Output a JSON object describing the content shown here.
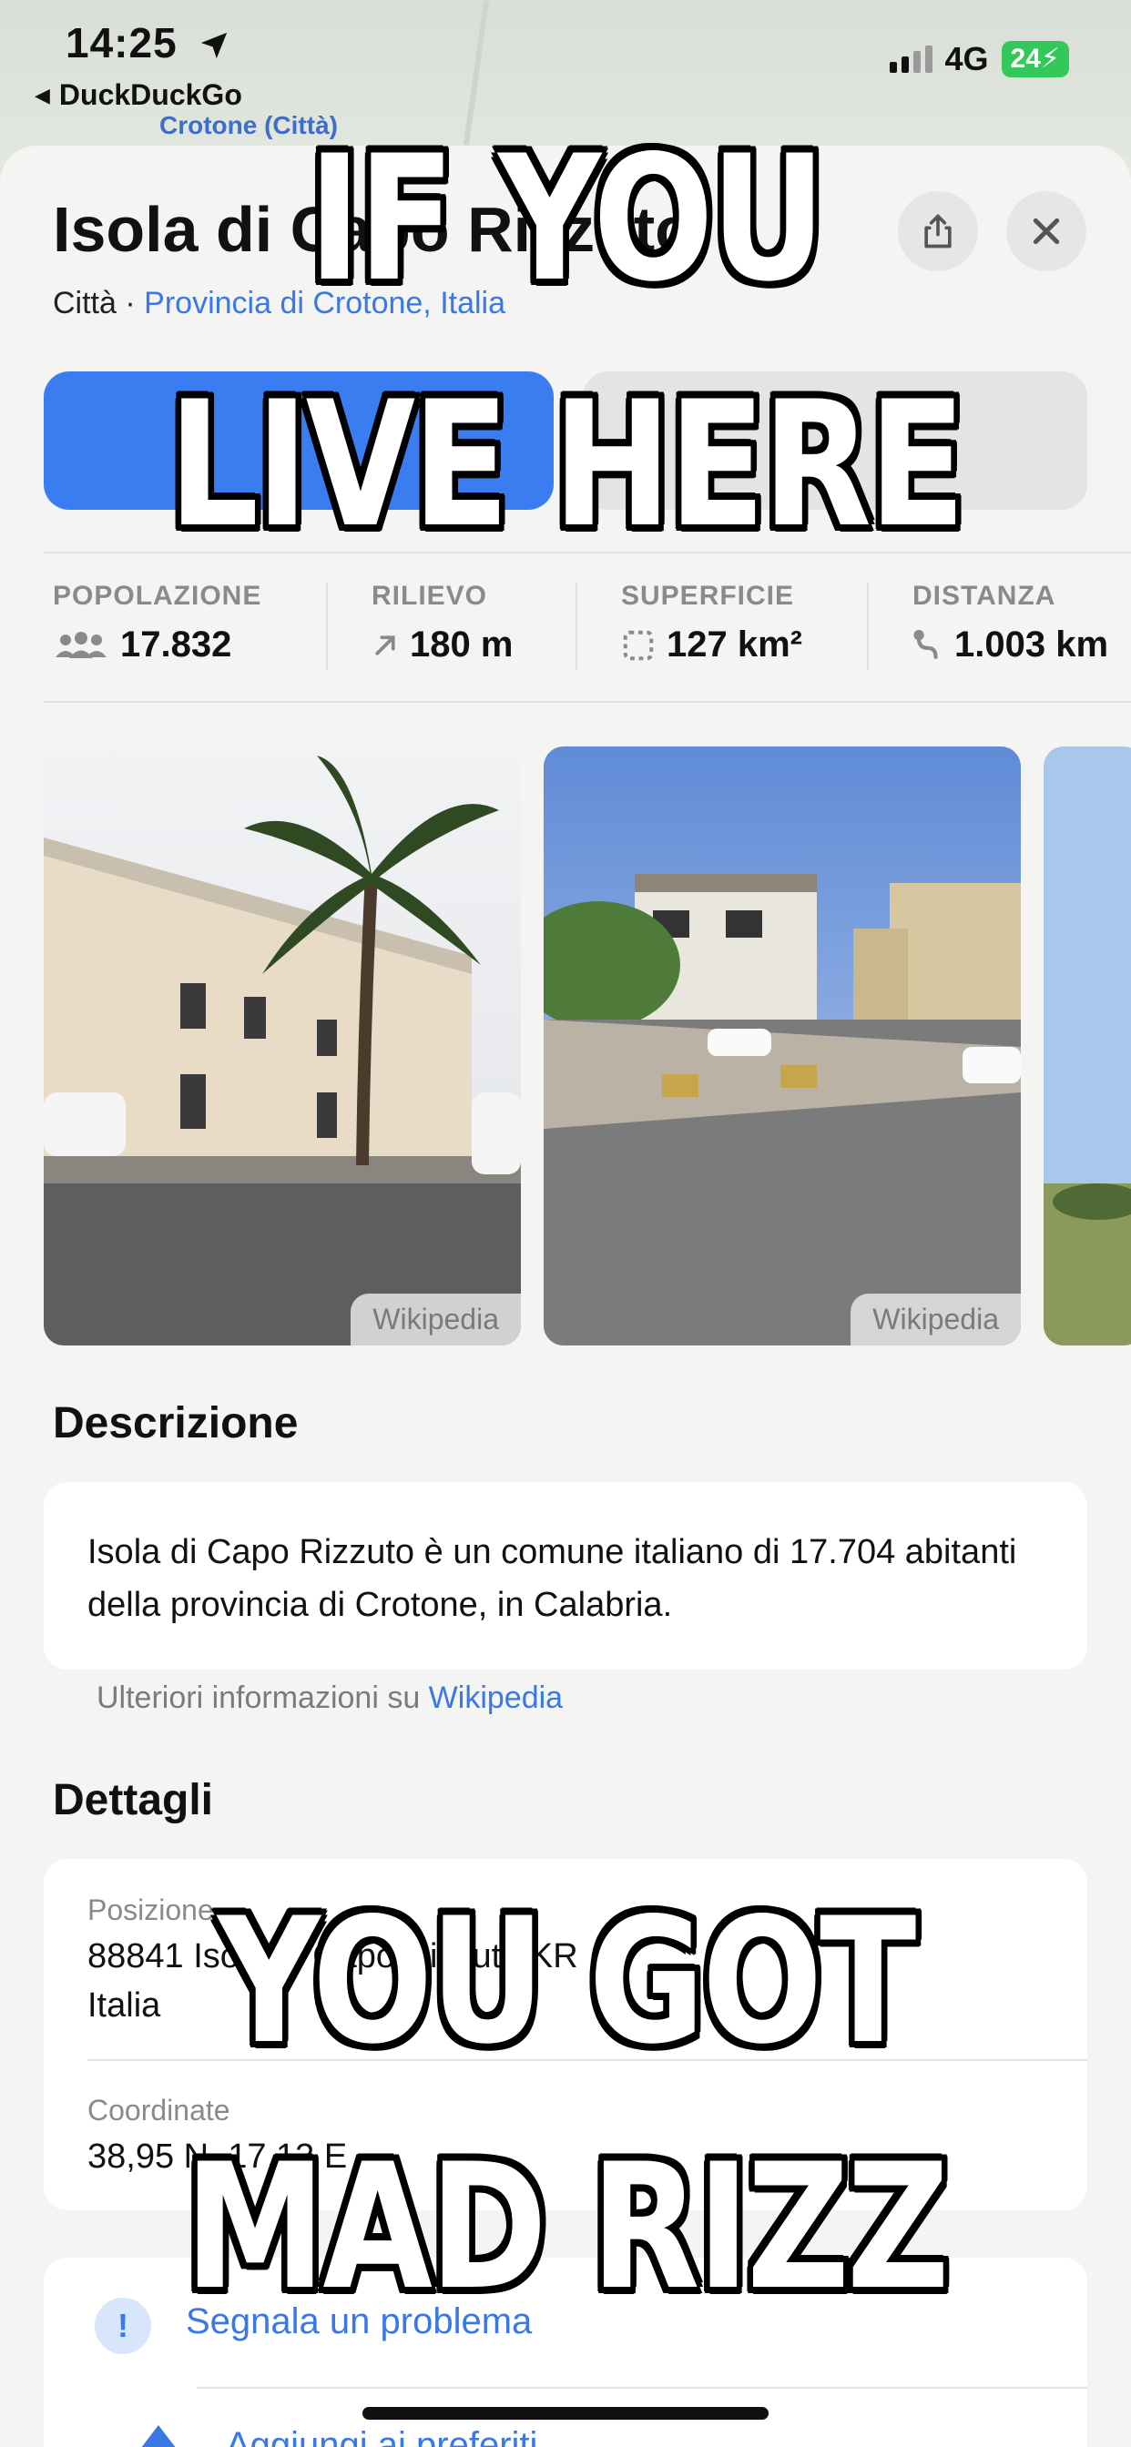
{
  "status_bar": {
    "time": "14:25",
    "back_app": "DuckDuckGo",
    "network": "4G",
    "battery": "24"
  },
  "map": {
    "label": "Crotone (Città)"
  },
  "place": {
    "title": "Isola di Capo Rizzuto",
    "type": "Città",
    "separator": "·",
    "region_link": "Provincia di Crotone, Italia"
  },
  "stats": [
    {
      "label": "POPOLAZIONE",
      "value": "17.832",
      "icon": "people-icon"
    },
    {
      "label": "RILIEVO",
      "value": "180 m",
      "icon": "elevation-arrow-icon"
    },
    {
      "label": "SUPERFICIE",
      "value": "127 km²",
      "icon": "area-icon"
    },
    {
      "label": "DISTANZA",
      "value": "1.003 km",
      "icon": "route-icon"
    }
  ],
  "photos": [
    {
      "credit": "Wikipedia"
    },
    {
      "credit": "Wikipedia"
    }
  ],
  "description": {
    "heading": "Descrizione",
    "text": "Isola di Capo Rizzuto è un comune italiano di 17.704 abitanti della provincia di Crotone, in Calabria.",
    "more_prefix": "Ulteriori informazioni su ",
    "more_link": "Wikipedia"
  },
  "details": {
    "heading": "Dettagli",
    "position_label": "Posizione",
    "position_value_1": "88841 Isola di Capo Rizzuto KR",
    "position_value_2": "Italia",
    "coords_label": "Coordinate",
    "coords_value": "38,95 N, 17,13 E"
  },
  "actions": {
    "report": "Segnala un problema",
    "add": "Aggiungi ai preferiti"
  },
  "meme": {
    "top_line_1": "IF YOU",
    "top_line_2": "LIVE HERE",
    "bottom_line_1": "YOU GOT",
    "bottom_line_2": "MAD RIZZ"
  },
  "colors": {
    "accent": "#3a7df0",
    "link": "#3a78e6",
    "battery": "#34c759"
  }
}
